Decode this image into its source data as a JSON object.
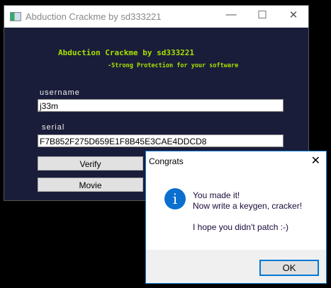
{
  "main_window": {
    "title": "Abduction Crackme by sd333221",
    "heading": "Abduction Crackme by sd333221",
    "subheading": "-Strong Protection for your software",
    "username_label": "username",
    "username_value": "j33m",
    "serial_label": "serial",
    "serial_value": "F7B852F275D659E1F8B45E3CAE4DDCD8",
    "verify_label": "Verify",
    "movie_label": "Movie",
    "minimize": "—",
    "maximize": "☐",
    "close": "✕"
  },
  "dialog": {
    "title": "Congrats",
    "close": "✕",
    "icon": "info-icon",
    "line1": "You made it!",
    "line2": "Now write a keygen, cracker!",
    "line3": "I hope you didn't patch :-)",
    "ok_label": "OK"
  }
}
